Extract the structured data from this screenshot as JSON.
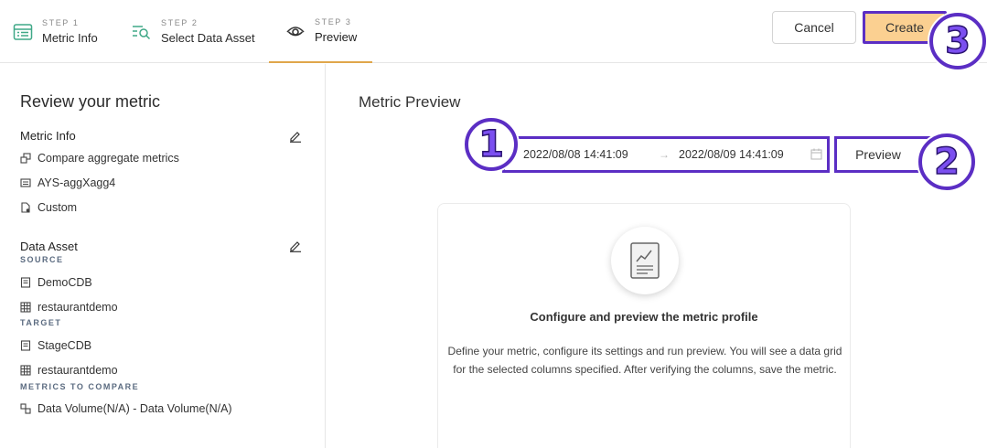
{
  "stepper": {
    "steps": [
      {
        "num": "STEP 1",
        "label": "Metric Info",
        "icon": "table-list-icon",
        "color": "#3fa887"
      },
      {
        "num": "STEP 2",
        "label": "Select Data Asset",
        "icon": "search-list-icon",
        "color": "#3fa887"
      },
      {
        "num": "STEP 3",
        "label": "Preview",
        "icon": "eye-icon",
        "color": "#333333"
      }
    ],
    "active_accent": "#e0a64b"
  },
  "header": {
    "cancel_label": "Cancel",
    "create_label": "Create"
  },
  "callouts": [
    "1",
    "2",
    "3"
  ],
  "left": {
    "title": "Review your metric",
    "metric_info": {
      "title": "Metric Info",
      "items": [
        {
          "icon": "compare-icon",
          "text": "Compare aggregate metrics"
        },
        {
          "icon": "list-icon",
          "text": "AYS-aggXagg4"
        },
        {
          "icon": "file-icon",
          "text": "Custom"
        }
      ]
    },
    "data_asset": {
      "title": "Data Asset",
      "source_caption": "SOURCE",
      "source": [
        {
          "icon": "database-icon",
          "text": "DemoCDB"
        },
        {
          "icon": "table-icon",
          "text": "restaurantdemo"
        }
      ],
      "target_caption": "TARGET",
      "target": [
        {
          "icon": "database-icon",
          "text": "StageCDB"
        },
        {
          "icon": "table-icon",
          "text": "restaurantdemo"
        }
      ],
      "compare_caption": "METRICS TO COMPARE",
      "compare": [
        {
          "icon": "link-icon",
          "text": "Data Volume(N/A) - Data Volume(N/A)"
        }
      ]
    }
  },
  "right": {
    "title": "Metric Preview",
    "date_start": "2022/08/08 14:41:09",
    "date_arrow": "→",
    "date_end": "2022/08/09 14:41:09",
    "preview_label": "Preview",
    "card": {
      "title": "Configure and preview the metric profile",
      "description": "Define your metric, configure its settings and run preview. You will see a data grid for the selected columns specified. After verifying the columns, save the metric."
    }
  },
  "colors": {
    "callout": "#5b2ec4",
    "create_bg": "#fbd091"
  }
}
